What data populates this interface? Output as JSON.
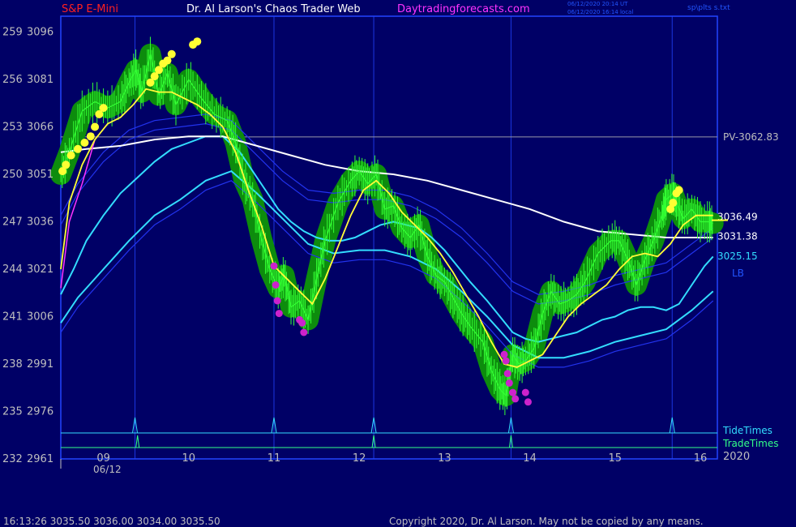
{
  "header": {
    "symbol": "S&P E-Mini",
    "author": "Dr. Al Larson's Chaos Trader Web",
    "site": "Daytradingforecasts.com",
    "utc_stamp": "06/12/2020 20:14 UT",
    "local_stamp": "06/12/2020 16:14 local",
    "plot_name": "sp\\plts s.txt",
    "colors": {
      "symbol": "#ff2020",
      "author": "#ffffff",
      "site": "#ff33ff",
      "stamp": "#2255ff"
    }
  },
  "footer": {
    "quote": "16:13:26  3035.50 3036.00 3034.00 3035.50",
    "copyright": "Copyright 2020, Dr. Al Larson. May not be copied by any means."
  },
  "chart_data": {
    "type": "line",
    "title": "S&P E-Mini",
    "ylim": [
      2961,
      3101
    ],
    "y_ticks": [
      {
        "value": 3096,
        "left": "259"
      },
      {
        "value": 3081,
        "left": "256"
      },
      {
        "value": 3066,
        "left": "253"
      },
      {
        "value": 3051,
        "left": "250"
      },
      {
        "value": 3036,
        "left": "247"
      },
      {
        "value": 3021,
        "left": "244"
      },
      {
        "value": 3006,
        "left": "241"
      },
      {
        "value": 2991,
        "left": "238"
      },
      {
        "value": 2976,
        "left": "235"
      },
      {
        "value": 2961,
        "left": "232"
      }
    ],
    "xlim": [
      8.5,
      16.2
    ],
    "x_ticks": [
      {
        "value": 9,
        "label": "09"
      },
      {
        "value": 10,
        "label": "10"
      },
      {
        "value": 11,
        "label": "11"
      },
      {
        "value": 12,
        "label": "12"
      },
      {
        "value": 13,
        "label": "13"
      },
      {
        "value": 14,
        "label": "14"
      },
      {
        "value": 15,
        "label": "15"
      },
      {
        "value": 16,
        "label": "16"
      }
    ],
    "date_label": "06/12",
    "year_label": "2020",
    "time_markers": [
      9.37,
      11.0,
      12.17,
      13.78,
      15.67
    ],
    "tide_times": [
      9.37,
      11.0,
      12.17,
      13.78,
      15.67
    ],
    "trade_times": [
      9.4,
      12.17,
      13.78
    ],
    "pivot": {
      "label": "PV-3062.83",
      "value": 3062.83
    },
    "value_labels": [
      {
        "text": "3036.49",
        "value": 3036.49,
        "color": "#ffffff"
      },
      {
        "text": "3031.38",
        "value": 3031.38,
        "color": "#ffffff"
      },
      {
        "text": "3025.15",
        "value": 3025.15,
        "color": "#33ddff"
      },
      {
        "text": "LB",
        "value": 3020.5,
        "color": "#2255ff"
      }
    ],
    "strip_labels": {
      "tide": "TideTimes",
      "trade": "TradeTimes"
    },
    "price": {
      "x": [
        8.5,
        8.6,
        8.75,
        8.9,
        9.05,
        9.2,
        9.3,
        9.38,
        9.45,
        9.55,
        9.65,
        9.75,
        9.85,
        10.0,
        10.15,
        10.3,
        10.45,
        10.55,
        10.65,
        10.75,
        10.85,
        10.95,
        11.05,
        11.12,
        11.2,
        11.3,
        11.4,
        11.5,
        11.6,
        11.75,
        11.9,
        12.0,
        12.1,
        12.2,
        12.3,
        12.4,
        12.5,
        12.6,
        12.7,
        12.8,
        12.9,
        13.0,
        13.1,
        13.2,
        13.3,
        13.45,
        13.55,
        13.65,
        13.72,
        13.8,
        13.87,
        13.95,
        14.05,
        14.15,
        14.25,
        14.35,
        14.45,
        14.55,
        14.65,
        14.8,
        14.95,
        15.05,
        15.15,
        15.25,
        15.35,
        15.45,
        15.55,
        15.6,
        15.68,
        15.72,
        15.8,
        15.9,
        16.0,
        16.1,
        16.15
      ],
      "y": [
        3051,
        3058,
        3071,
        3074,
        3072,
        3074,
        3080,
        3084,
        3077,
        3089,
        3076,
        3083,
        3073,
        3081,
        3075,
        3070,
        3068,
        3061,
        3049,
        3043,
        3031,
        3021,
        3015,
        3019,
        3009,
        3011,
        3005,
        3018,
        3030,
        3042,
        3049,
        3052,
        3048,
        3051,
        3040,
        3041,
        3034,
        3031,
        3035,
        3025,
        3019,
        3017,
        3012,
        3007,
        3003,
        2998,
        2989,
        2983,
        2981,
        2994,
        2991,
        2992,
        2996,
        3007,
        3014,
        3010,
        3011,
        3013,
        3017,
        3026,
        3030,
        3030,
        3024,
        3016,
        3024,
        3030,
        3038,
        3043,
        3045,
        3042,
        3037,
        3040,
        3036,
        3036,
        3035.5
      ]
    },
    "fast_ma": {
      "x": [
        8.5,
        8.6,
        8.75,
        8.9,
        9.05,
        9.2,
        9.35,
        9.5,
        9.65,
        9.8,
        9.95,
        10.1,
        10.25,
        10.4,
        10.55,
        10.7,
        10.85,
        11.0,
        11.15,
        11.3,
        11.45,
        11.6,
        11.75,
        11.9,
        12.05,
        12.2,
        12.35,
        12.5,
        12.65,
        12.8,
        12.95,
        13.1,
        13.25,
        13.4,
        13.55,
        13.7,
        13.85,
        14.0,
        14.15,
        14.3,
        14.45,
        14.6,
        14.75,
        14.9,
        15.05,
        15.2,
        15.35,
        15.5,
        15.65,
        15.8,
        15.95,
        16.15
      ],
      "y": [
        3021,
        3042,
        3054,
        3062,
        3067,
        3069,
        3073,
        3078,
        3077,
        3077,
        3075,
        3073,
        3070,
        3066,
        3058,
        3046,
        3035,
        3022,
        3018,
        3014,
        3010,
        3018,
        3028,
        3038,
        3046,
        3049,
        3045,
        3039,
        3035,
        3031,
        3026,
        3020,
        3013,
        3006,
        2998,
        2991,
        2990,
        2992,
        2994,
        3000,
        3006,
        3010,
        3013,
        3016,
        3021,
        3025,
        3026,
        3025,
        3029,
        3035,
        3038,
        3038
      ]
    },
    "medium_ma": {
      "x": [
        8.5,
        8.65,
        8.8,
        9.0,
        9.2,
        9.4,
        9.6,
        9.8,
        10.0,
        10.2,
        10.4,
        10.6,
        10.75,
        10.9,
        11.05,
        11.2,
        11.35,
        11.5,
        11.65,
        11.8,
        11.95,
        12.1,
        12.25,
        12.4,
        12.55,
        12.7,
        12.85,
        13.0,
        13.15,
        13.3,
        13.5,
        13.65,
        13.8,
        13.95,
        14.1,
        14.25,
        14.4,
        14.55,
        14.7,
        14.85,
        15.0,
        15.15,
        15.3,
        15.45,
        15.6,
        15.75,
        15.9,
        16.05,
        16.15
      ],
      "y": [
        3013,
        3021,
        3030,
        3038,
        3045,
        3050,
        3055,
        3059,
        3061,
        3063,
        3063,
        3058,
        3052,
        3046,
        3040,
        3036,
        3033,
        3031,
        3030,
        3030,
        3031,
        3033,
        3035,
        3036,
        3035,
        3034,
        3031,
        3027,
        3022,
        3017,
        3011,
        3006,
        3001,
        2999,
        2998,
        2999,
        3000,
        3001,
        3003,
        3005,
        3006,
        3008,
        3009,
        3009,
        3008,
        3010,
        3016,
        3022,
        3025
      ]
    },
    "slow_ma": {
      "x": [
        8.5,
        8.8,
        9.2,
        9.6,
        10.0,
        10.4,
        10.8,
        11.2,
        11.6,
        12.0,
        12.4,
        12.8,
        13.2,
        13.6,
        14.0,
        14.4,
        14.8,
        15.2,
        15.6,
        16.0,
        16.15
      ],
      "y": [
        3058,
        3059,
        3060,
        3062,
        3063,
        3063,
        3060,
        3057,
        3054,
        3052,
        3051,
        3049,
        3046,
        3043,
        3040,
        3036,
        3033,
        3032,
        3031,
        3031,
        3031
      ]
    },
    "bands": {
      "x": [
        8.5,
        8.7,
        9.0,
        9.3,
        9.6,
        9.9,
        10.2,
        10.5,
        10.8,
        11.1,
        11.4,
        11.7,
        12.0,
        12.3,
        12.6,
        12.9,
        13.2,
        13.5,
        13.8,
        14.1,
        14.4,
        14.7,
        15.0,
        15.3,
        15.6,
        15.9,
        16.15
      ],
      "upper": [
        3035,
        3045,
        3055,
        3062,
        3065,
        3066,
        3067,
        3065,
        3057,
        3049,
        3043,
        3042,
        3043,
        3043,
        3041,
        3037,
        3031,
        3023,
        3014,
        3010,
        3011,
        3013,
        3016,
        3018,
        3020,
        3026,
        3031
      ],
      "lower": [
        3004,
        3012,
        3021,
        3030,
        3038,
        3043,
        3049,
        3052,
        3045,
        3037,
        3029,
        3026,
        3027,
        3027,
        3025,
        3021,
        3014,
        3006,
        2997,
        2993,
        2993,
        2995,
        2998,
        3000,
        3002,
        3008,
        3014
      ]
    },
    "magenta_dots": [
      [
        11.0,
        3022
      ],
      [
        11.02,
        3016
      ],
      [
        11.04,
        3011
      ],
      [
        11.06,
        3007
      ],
      [
        11.3,
        3005
      ],
      [
        11.33,
        3004
      ],
      [
        11.35,
        3001
      ],
      [
        13.7,
        2994
      ],
      [
        13.72,
        2992
      ],
      [
        13.74,
        2988
      ],
      [
        13.76,
        2985
      ],
      [
        13.8,
        2982
      ],
      [
        13.83,
        2980
      ],
      [
        13.95,
        2982
      ],
      [
        13.98,
        2979
      ]
    ],
    "yellow_dots": [
      [
        8.52,
        3052
      ],
      [
        8.56,
        3054
      ],
      [
        8.62,
        3057
      ],
      [
        8.7,
        3059
      ],
      [
        8.78,
        3061
      ],
      [
        8.85,
        3063
      ],
      [
        8.9,
        3066
      ],
      [
        8.95,
        3070
      ],
      [
        9.0,
        3072
      ],
      [
        9.55,
        3080
      ],
      [
        9.6,
        3082
      ],
      [
        9.65,
        3084
      ],
      [
        9.7,
        3086
      ],
      [
        9.75,
        3087
      ],
      [
        9.8,
        3089
      ],
      [
        10.05,
        3092
      ],
      [
        10.1,
        3093
      ],
      [
        15.65,
        3040
      ],
      [
        15.68,
        3042
      ],
      [
        15.72,
        3045
      ],
      [
        15.75,
        3046
      ]
    ],
    "colors": {
      "price": "#33ff33",
      "halo": "#0d8c0d",
      "fast_ma": "#ffff33",
      "medium_ma": "#ff33ff",
      "band_inner": "#33ddff",
      "band_outer": "#2233ee",
      "slow_ma": "#ffffff",
      "pivot": "#9999aa",
      "frame": "#2244ff",
      "tide": "#33ddff",
      "trade": "#33ff88",
      "magenta_dot": "#cc22cc",
      "yellow_dot": "#ffff33",
      "axis_text": "#bfbfbf"
    }
  }
}
